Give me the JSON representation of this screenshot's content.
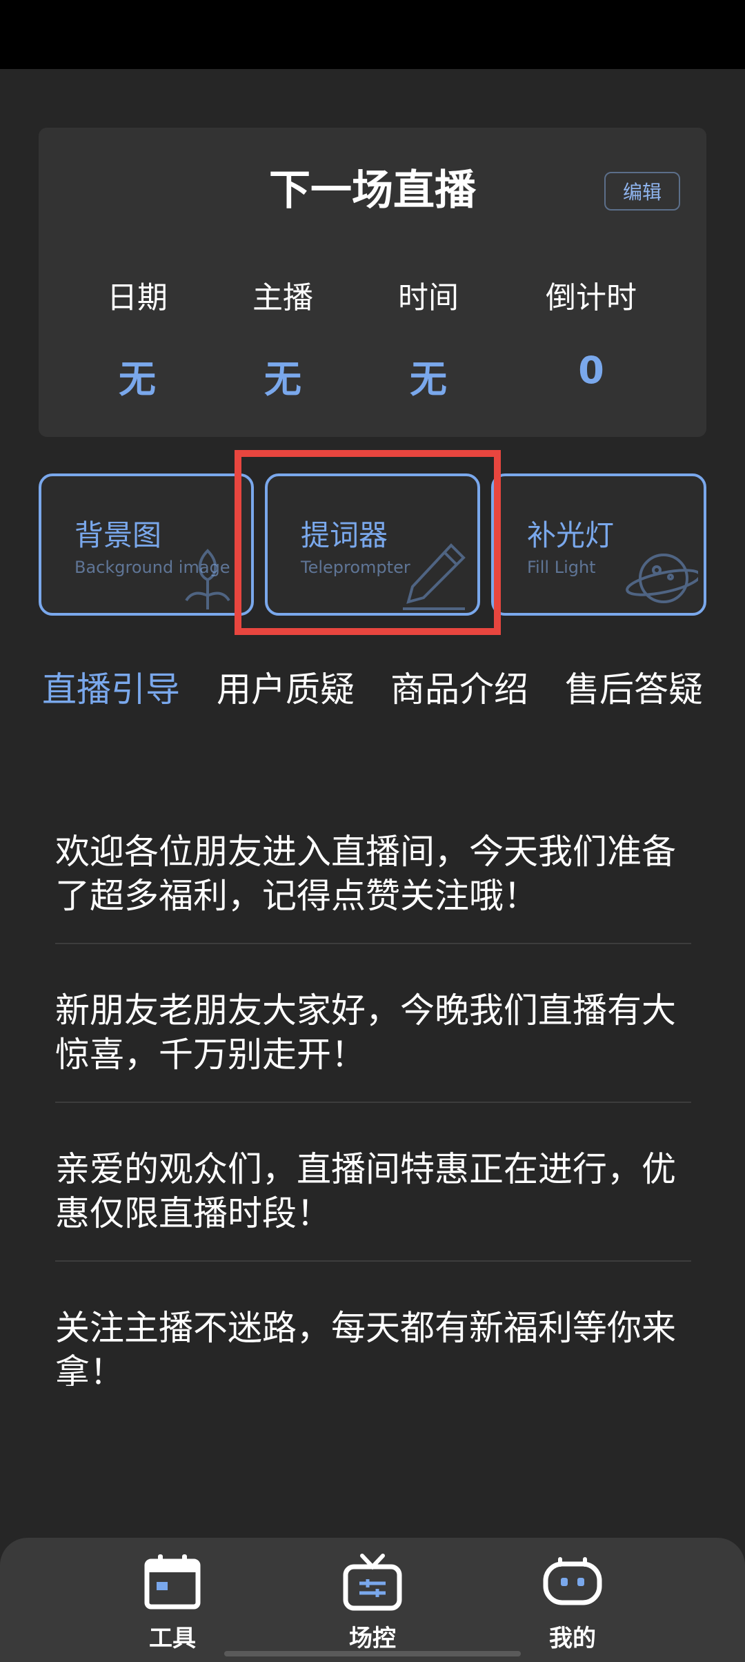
{
  "next_live": {
    "title": "下一场直播",
    "edit_label": "编辑",
    "columns": [
      {
        "label": "日期",
        "value": "无"
      },
      {
        "label": "主播",
        "value": "无"
      },
      {
        "label": "时间",
        "value": "无"
      },
      {
        "label": "倒计时",
        "value": "0"
      }
    ]
  },
  "tools": [
    {
      "title": "背景图",
      "subtitle": "Background image",
      "icon": "flower-icon"
    },
    {
      "title": "提词器",
      "subtitle": "Teleprompter",
      "icon": "pen-icon"
    },
    {
      "title": "补光灯",
      "subtitle": "Fill Light",
      "icon": "planet-icon"
    }
  ],
  "category_tabs": [
    {
      "label": "直播引导",
      "active": true
    },
    {
      "label": "用户质疑",
      "active": false
    },
    {
      "label": "商品介绍",
      "active": false
    },
    {
      "label": "售后答疑",
      "active": false
    }
  ],
  "scripts": [
    "欢迎各位朋友进入直播间，今天我们准备了超多福利，记得点赞关注哦！",
    "新朋友老朋友大家好，今晚我们直播有大惊喜，千万别走开！",
    "亲爱的观众们，直播间特惠正在进行，优惠仅限直播时段！",
    "关注主播不迷路，每天都有新福利等你来拿！"
  ],
  "bottom_nav": [
    {
      "label": "工具",
      "icon": "calendar-icon"
    },
    {
      "label": "场控",
      "icon": "tv-icon"
    },
    {
      "label": "我的",
      "icon": "robot-icon"
    }
  ],
  "colors": {
    "accent": "#7aa8ec",
    "highlight": "#e8463f",
    "background": "#262626",
    "card": "#333333"
  }
}
